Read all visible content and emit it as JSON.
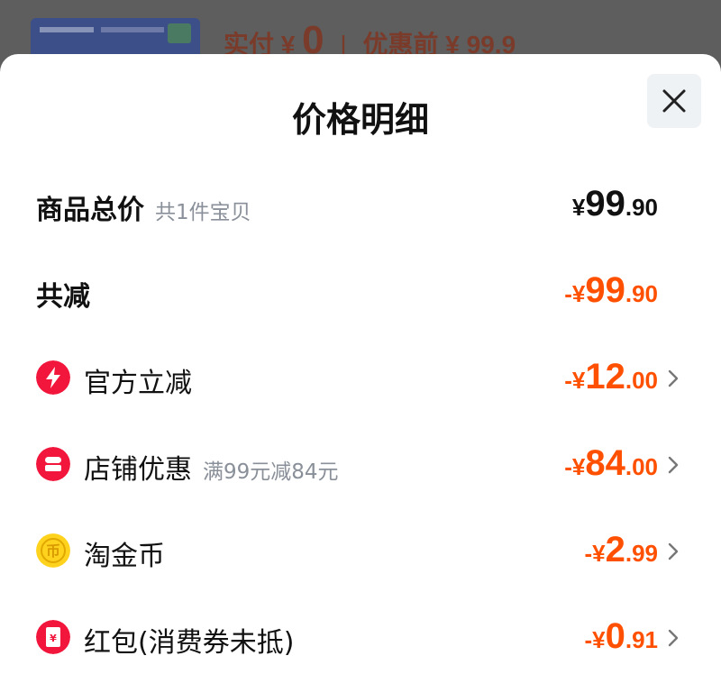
{
  "background": {
    "paid_prefix": "实付",
    "paid_currency": "¥",
    "paid_value": "0",
    "before_label": "优惠前",
    "before_currency": "¥",
    "before_value": "99.9"
  },
  "sheet": {
    "title": "价格明细",
    "close_icon": "close-icon"
  },
  "rows": {
    "total": {
      "label": "商品总价",
      "sublabel": "共1件宝贝",
      "currency": "¥",
      "int": "99",
      "dec": ".90"
    },
    "reduced": {
      "label": "共减",
      "currency": "-¥",
      "int": "99",
      "dec": ".90"
    },
    "official": {
      "label": "官方立减",
      "icon": "lightning-icon",
      "currency": "-¥",
      "int": "12",
      "dec": ".00"
    },
    "store": {
      "label": "店铺优惠",
      "sublabel": "满99元减84元",
      "icon": "store-icon",
      "currency": "-¥",
      "int": "84",
      "dec": ".00"
    },
    "coin": {
      "label": "淘金币",
      "icon": "gold-coin-icon",
      "currency": "-¥",
      "int": "2",
      "dec": ".99"
    },
    "redpacket": {
      "label": "红包(消费券未抵)",
      "icon": "red-packet-icon",
      "currency": "-¥",
      "int": "0",
      "dec": ".91"
    }
  },
  "colors": {
    "accent": "#ff5000",
    "icon_red": "#f2163c",
    "coin_yellow": "#ffd21e"
  }
}
